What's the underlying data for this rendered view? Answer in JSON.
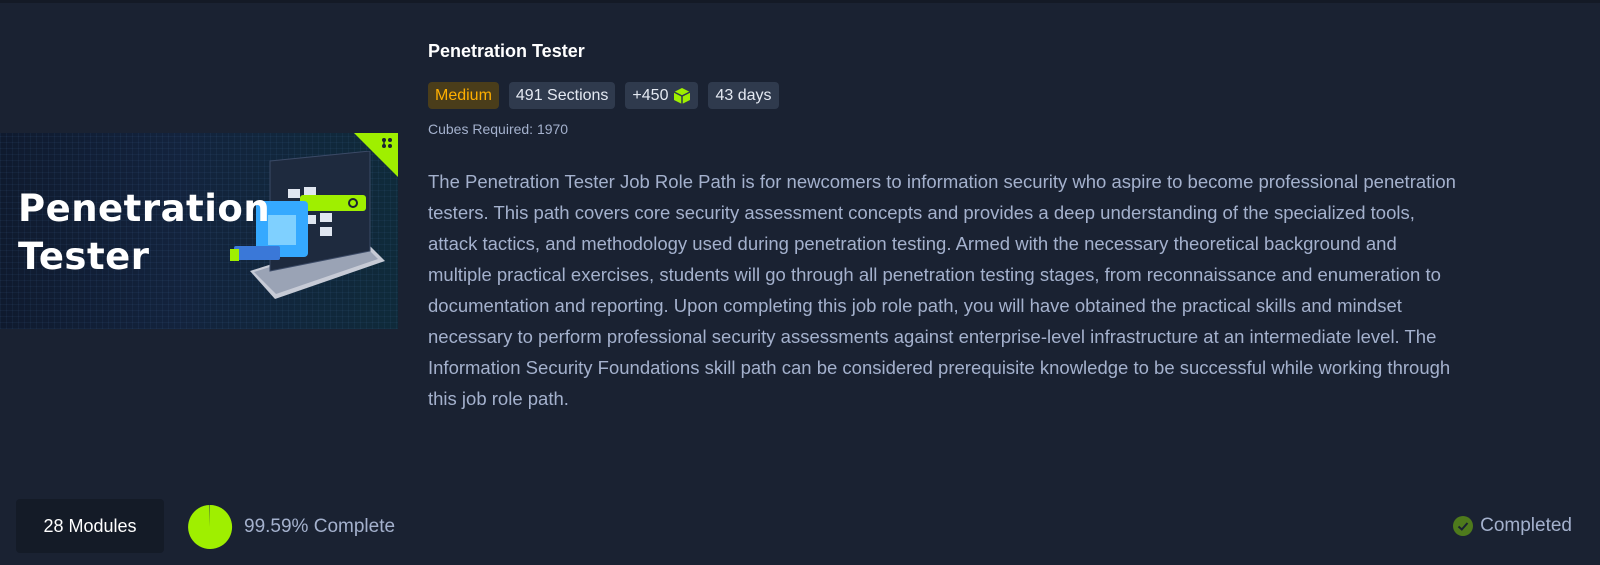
{
  "path": {
    "title": "Penetration Tester",
    "banner_lines": [
      "Penetration",
      "Tester"
    ],
    "badges": {
      "difficulty": "Medium",
      "sections": "491 Sections",
      "cubes": "+450",
      "duration": "43 days"
    },
    "cubes_required": "Cubes Required: 1970",
    "description": "The Penetration Tester Job Role Path is for newcomers to information security who aspire to become professional penetration testers. This path covers core security assessment concepts and provides a deep understanding of the specialized tools, attack tactics, and methodology used during penetration testing. Armed with the necessary theoretical background and multiple practical exercises, students will go through all penetration testing stages, from reconnaissance and enumeration to documentation and reporting. Upon completing this job role path, you will have obtained the practical skills and mindset necessary to perform professional security assessments against enterprise-level infrastructure at an intermediate level. The Information Security Foundations skill path can be considered prerequisite knowledge to be successful while working through this job role path."
  },
  "footer": {
    "modules": "28 Modules",
    "progress_text": "99.59% Complete",
    "progress_fraction": 0.9959,
    "status": "Completed"
  },
  "colors": {
    "accent": "#9fef00",
    "medium": "#ffaf00",
    "background": "#1a2232"
  },
  "icons": {
    "cube": "cube-icon",
    "status": "check-circle-icon",
    "corner": "path-icon"
  }
}
